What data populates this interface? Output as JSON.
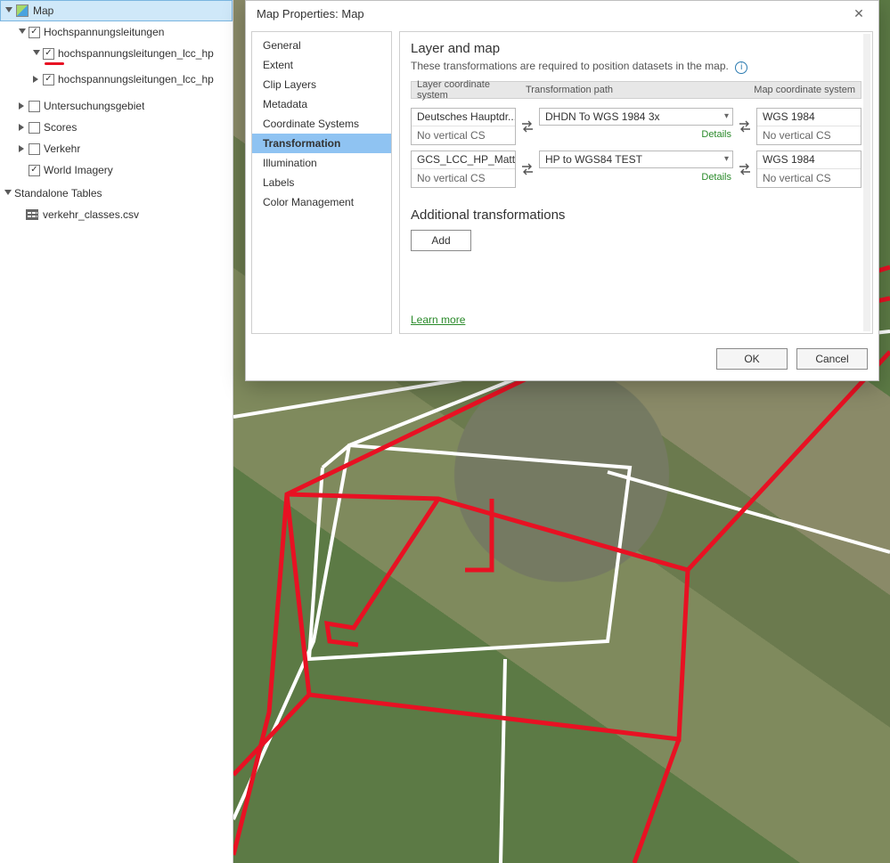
{
  "toc": {
    "root": "Map",
    "layers": [
      {
        "label": "Hochspannungsleitungen",
        "checked": true,
        "indent": 1,
        "expandable": true,
        "open": true
      },
      {
        "label": "hochspannungsleitungen_lcc_hp",
        "checked": true,
        "indent": 2,
        "expandable": true,
        "open": true,
        "redline": true
      },
      {
        "label": "hochspannungsleitungen_lcc_hp",
        "checked": true,
        "indent": 2,
        "expandable": true,
        "open": false
      },
      {
        "label": "Untersuchungsgebiet",
        "checked": false,
        "indent": 1,
        "expandable": true,
        "open": false
      },
      {
        "label": "Scores",
        "checked": false,
        "indent": 1,
        "expandable": true,
        "open": false
      },
      {
        "label": "Verkehr",
        "checked": false,
        "indent": 1,
        "expandable": true,
        "open": false
      },
      {
        "label": "World Imagery",
        "checked": true,
        "indent": 1,
        "expandable": false
      }
    ],
    "standalone_header": "Standalone Tables",
    "tables": [
      {
        "label": "verkehr_classes.csv"
      }
    ]
  },
  "dialog": {
    "title": "Map Properties: Map",
    "nav": [
      "General",
      "Extent",
      "Clip Layers",
      "Metadata",
      "Coordinate Systems",
      "Transformation",
      "Illumination",
      "Labels",
      "Color Management"
    ],
    "nav_active": "Transformation",
    "content": {
      "section_title": "Layer and map",
      "section_sub": "These transformations are required to position datasets in the map.",
      "head": {
        "layer": "Layer coordinate system",
        "path": "Transformation path",
        "map": "Map coordinate system"
      },
      "rows": [
        {
          "layer_cs": "Deutsches Hauptdr...",
          "layer_vert": "No vertical CS",
          "path": "DHDN To WGS 1984 3x",
          "details": "Details",
          "map_cs": "WGS 1984",
          "map_vert": "No vertical CS"
        },
        {
          "layer_cs": "GCS_LCC_HP_Matt...",
          "layer_vert": "No vertical CS",
          "path": "HP to WGS84 TEST",
          "details": "Details",
          "map_cs": "WGS 1984",
          "map_vert": "No vertical CS"
        }
      ],
      "additional_title": "Additional transformations",
      "add_label": "Add",
      "learn_more": "Learn more"
    },
    "ok": "OK",
    "cancel": "Cancel"
  }
}
